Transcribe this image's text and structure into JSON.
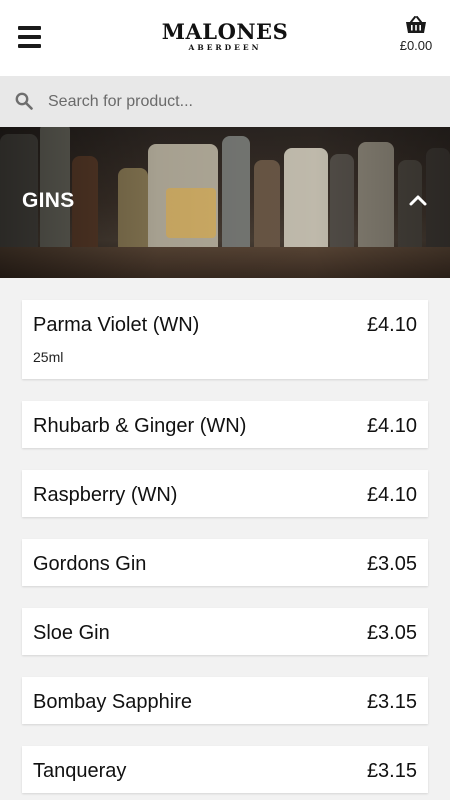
{
  "header": {
    "logo_main": "MALONES",
    "logo_sub": "ABERDEEN",
    "basket_total": "£0.00",
    "menu_icon": "hamburger-menu-icon",
    "basket_icon": "basket-icon"
  },
  "search": {
    "placeholder": "Search for product...",
    "value": "",
    "icon": "search-icon"
  },
  "category": {
    "title": "GINS",
    "toggle_icon": "chevron-up-icon"
  },
  "products": [
    {
      "name": "Parma Violet (WN)",
      "price": "£4.10",
      "size": "25ml"
    },
    {
      "name": "Rhubarb & Ginger (WN)",
      "price": "£4.10"
    },
    {
      "name": "Raspberry (WN)",
      "price": "£4.10"
    },
    {
      "name": "Gordons Gin",
      "price": "£3.05"
    },
    {
      "name": "Sloe Gin",
      "price": "£3.05"
    },
    {
      "name": "Bombay Sapphire",
      "price": "£3.15"
    },
    {
      "name": "Tanqueray",
      "price": "£3.15"
    }
  ],
  "colors": {
    "page_background": "#f2f2f2",
    "header_background": "#ffffff",
    "search_background": "#e8e8e8",
    "text": "#111111"
  }
}
